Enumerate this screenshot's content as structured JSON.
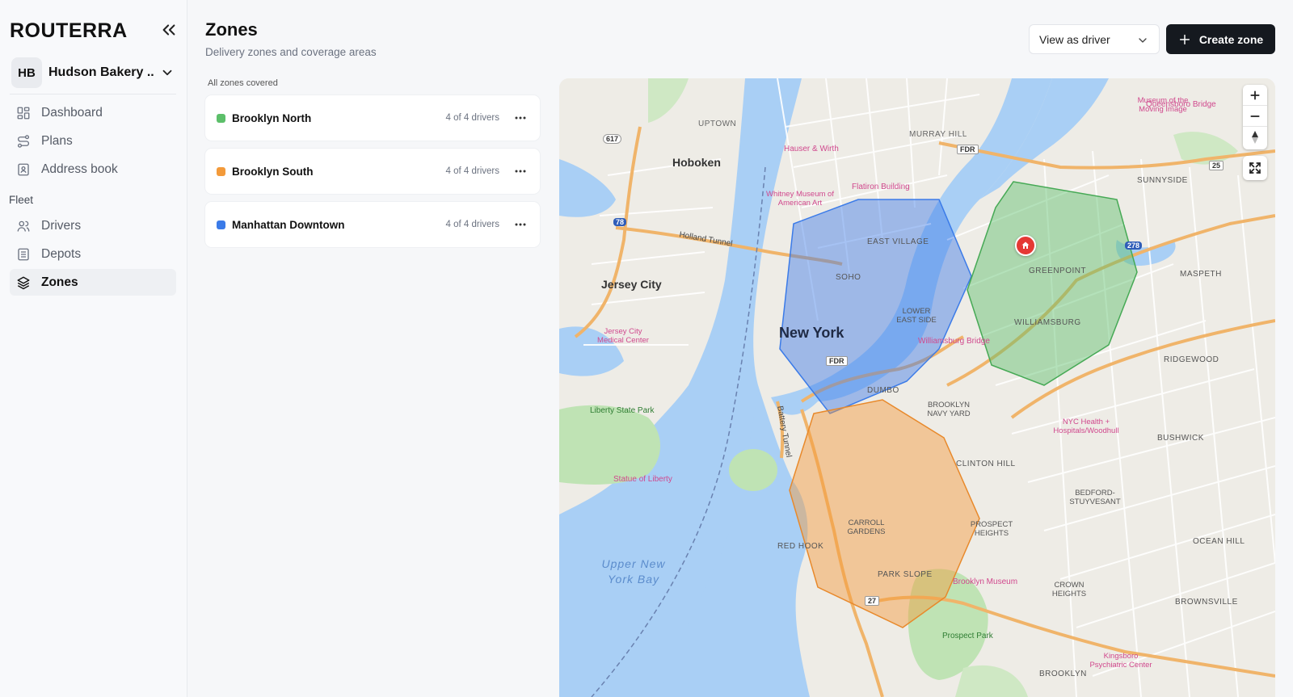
{
  "sidebar": {
    "logo": "ROUTERRA",
    "org": {
      "initials": "HB",
      "name": "Hudson Bakery ..."
    },
    "nav": [
      {
        "label": "Dashboard",
        "icon": "dashboard-icon"
      },
      {
        "label": "Plans",
        "icon": "route-icon"
      },
      {
        "label": "Address book",
        "icon": "address-book-icon"
      }
    ],
    "fleet_section": "Fleet",
    "fleet_nav": [
      {
        "label": "Drivers",
        "icon": "users-icon"
      },
      {
        "label": "Depots",
        "icon": "building-icon"
      },
      {
        "label": "Zones",
        "icon": "layers-icon",
        "active": true
      }
    ]
  },
  "header": {
    "title": "Zones",
    "subtitle": "Delivery zones and coverage areas",
    "view_select": "View as driver",
    "create_label": "Create zone"
  },
  "zones": {
    "status": "All zones covered",
    "items": [
      {
        "name": "Brooklyn North",
        "drivers": "4 of 4 drivers",
        "color": "#5cbf6a"
      },
      {
        "name": "Brooklyn South",
        "drivers": "4 of 4 drivers",
        "color": "#f39a3a"
      },
      {
        "name": "Manhattan Downtown",
        "drivers": "4 of 4 drivers",
        "color": "#3b7be8"
      }
    ]
  },
  "map": {
    "labels": {
      "hoboken": "Hoboken",
      "jersey_city": "Jersey City",
      "new_york": "New York",
      "uptown": "UPTOWN",
      "murray_hill": "MURRAY HILL",
      "east_village": "EAST VILLAGE",
      "soho": "SOHO",
      "lower_east_side": "LOWER EAST SIDE",
      "dumbo": "DUMBO",
      "brooklyn_navy_yard": "BROOKLYN NAVY YARD",
      "greenpoint": "GREENPOINT",
      "williamsburg": "WILLIAMSBURG",
      "sunnyside": "SUNNYSIDE",
      "maspeth": "MASPETH",
      "ridgewood": "RIDGEWOOD",
      "bushwick": "BUSHWICK",
      "bedford_stuyvesant": "BEDFORD-STUYVESANT",
      "clinton_hill": "CLINTON HILL",
      "prospect_heights": "PROSPECT HEIGHTS",
      "carroll_gardens": "CARROLL GARDENS",
      "red_hook": "RED HOOK",
      "park_slope": "PARK SLOPE",
      "crown_heights": "CROWN HEIGHTS",
      "brownsville": "BROWNSVILLE",
      "ocean_hill": "OCEAN HILL",
      "brooklyn": "BROOKLYN",
      "upper_bay": "Upper New York Bay",
      "liberty_state_park": "Liberty State Park",
      "statue_of_liberty": "Statue of Liberty",
      "flatiron": "Flatiron Building",
      "whitney": "Whitney Museum of American Art",
      "hauser": "Hauser & Wirth",
      "queensboro": "Queensboro Bridge",
      "moving_image": "Museum of the Moving Image",
      "williamsburg_bridge": "Williamsburg Bridge",
      "jersey_city_medical": "Jersey City Medical Center",
      "nyc_health": "NYC Health + Hospitals/Woodhull",
      "brooklyn_museum": "Brooklyn Museum",
      "prospect_park": "Prospect Park",
      "kingsboro": "Kingsboro Psychiatric Center",
      "holland_tunnel": "Holland Tunnel",
      "battery_tunnel": "Battery Tunnel",
      "fdr": "FDR",
      "highway_278": "278",
      "highway_78": "78",
      "highway_617": "617",
      "highway_25": "25",
      "highway_27": "27"
    }
  }
}
